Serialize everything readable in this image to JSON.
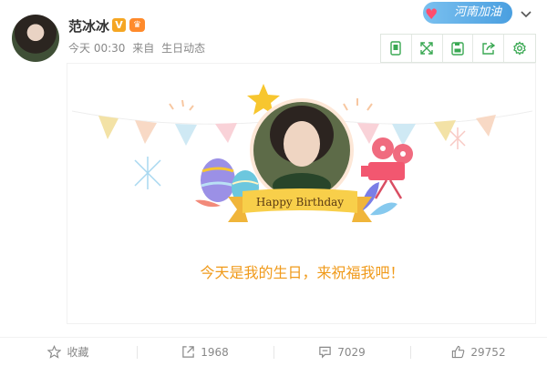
{
  "post": {
    "username": "范冰冰",
    "v_badge": "V",
    "time": "今天 00:30",
    "source_prefix": "来自",
    "source": "生日动态"
  },
  "topic_badge": {
    "text": "河南加油",
    "icon": "heart-icon",
    "color": "#4a9fe0"
  },
  "toolbar": {
    "icons": [
      "phone-icon",
      "expand-icon",
      "save-icon",
      "share-icon",
      "settings-icon"
    ],
    "color": "#3aa853"
  },
  "card": {
    "banner_text": "Happy Birthday",
    "message": "今天是我的生日，来祝福我吧！",
    "message_color": "#f09a1a"
  },
  "footer": {
    "favorite_label": "收藏",
    "repost_count": "1968",
    "comment_count": "7029",
    "like_count": "29752"
  }
}
